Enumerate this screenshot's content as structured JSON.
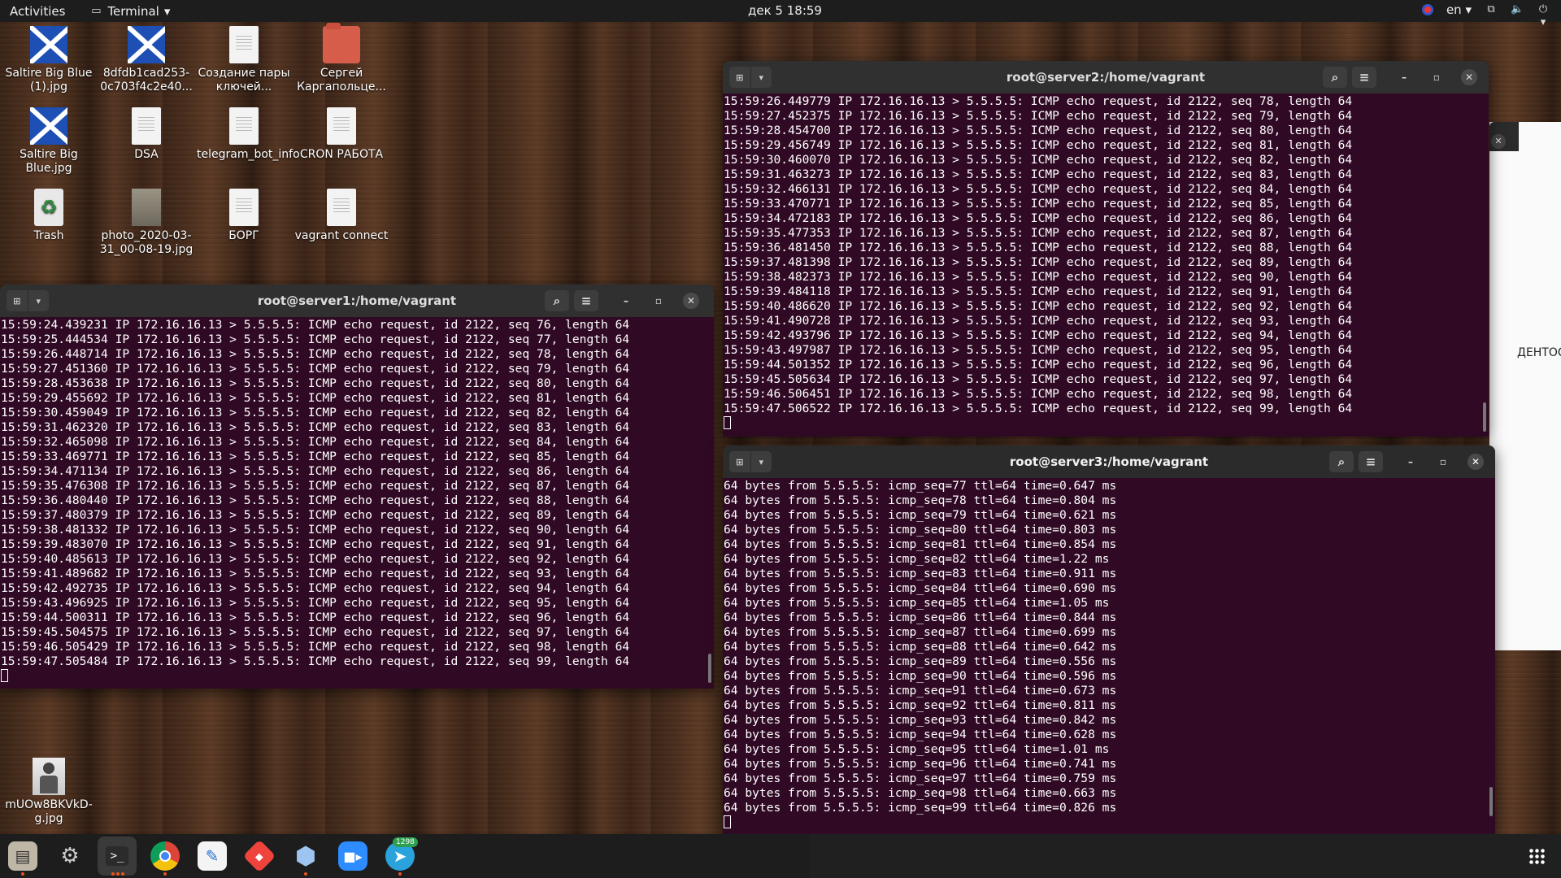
{
  "topbar": {
    "activities": "Activities",
    "app_menu": "Terminal",
    "clock": "дек 5  18:59",
    "language": "en"
  },
  "desktop_icons": [
    {
      "label": "Saltire Big Blue (1).jpg",
      "icon": "image-flag-icon"
    },
    {
      "label": "8dfdb1cad253-0c703f4c2e40...",
      "icon": "image-flag-icon"
    },
    {
      "label": "Создание пары ключей...",
      "icon": "document-icon"
    },
    {
      "label": "Сергей Каргапольце...",
      "icon": "folder-icon"
    },
    {
      "label": "Saltire Big Blue.jpg",
      "icon": "image-flag-icon"
    },
    {
      "label": "DSA",
      "icon": "document-icon"
    },
    {
      "label": "telegram_bot_info",
      "icon": "document-icon"
    },
    {
      "label": "CRON РАБОТА",
      "icon": "document-icon"
    },
    {
      "label": "Trash",
      "icon": "trash-icon"
    },
    {
      "label": "photo_2020-03-31_00-08-19.jpg",
      "icon": "image-icon"
    },
    {
      "label": "БОРГ",
      "icon": "document-icon"
    },
    {
      "label": "vagrant connect",
      "icon": "document-icon"
    },
    {
      "label": "mUOw8BKVkD-g.jpg",
      "icon": "image-person-icon"
    }
  ],
  "terminals": {
    "server1": {
      "title": "root@server1:/home/vagrant",
      "lines": [
        "15:59:24.439231 IP 172.16.16.13 > 5.5.5.5: ICMP echo request, id 2122, seq 76, length 64",
        "15:59:25.444534 IP 172.16.16.13 > 5.5.5.5: ICMP echo request, id 2122, seq 77, length 64",
        "15:59:26.448714 IP 172.16.16.13 > 5.5.5.5: ICMP echo request, id 2122, seq 78, length 64",
        "15:59:27.451360 IP 172.16.16.13 > 5.5.5.5: ICMP echo request, id 2122, seq 79, length 64",
        "15:59:28.453638 IP 172.16.16.13 > 5.5.5.5: ICMP echo request, id 2122, seq 80, length 64",
        "15:59:29.455692 IP 172.16.16.13 > 5.5.5.5: ICMP echo request, id 2122, seq 81, length 64",
        "15:59:30.459049 IP 172.16.16.13 > 5.5.5.5: ICMP echo request, id 2122, seq 82, length 64",
        "15:59:31.462320 IP 172.16.16.13 > 5.5.5.5: ICMP echo request, id 2122, seq 83, length 64",
        "15:59:32.465098 IP 172.16.16.13 > 5.5.5.5: ICMP echo request, id 2122, seq 84, length 64",
        "15:59:33.469771 IP 172.16.16.13 > 5.5.5.5: ICMP echo request, id 2122, seq 85, length 64",
        "15:59:34.471134 IP 172.16.16.13 > 5.5.5.5: ICMP echo request, id 2122, seq 86, length 64",
        "15:59:35.476308 IP 172.16.16.13 > 5.5.5.5: ICMP echo request, id 2122, seq 87, length 64",
        "15:59:36.480440 IP 172.16.16.13 > 5.5.5.5: ICMP echo request, id 2122, seq 88, length 64",
        "15:59:37.480379 IP 172.16.16.13 > 5.5.5.5: ICMP echo request, id 2122, seq 89, length 64",
        "15:59:38.481332 IP 172.16.16.13 > 5.5.5.5: ICMP echo request, id 2122, seq 90, length 64",
        "15:59:39.483070 IP 172.16.16.13 > 5.5.5.5: ICMP echo request, id 2122, seq 91, length 64",
        "15:59:40.485613 IP 172.16.16.13 > 5.5.5.5: ICMP echo request, id 2122, seq 92, length 64",
        "15:59:41.489682 IP 172.16.16.13 > 5.5.5.5: ICMP echo request, id 2122, seq 93, length 64",
        "15:59:42.492735 IP 172.16.16.13 > 5.5.5.5: ICMP echo request, id 2122, seq 94, length 64",
        "15:59:43.496925 IP 172.16.16.13 > 5.5.5.5: ICMP echo request, id 2122, seq 95, length 64",
        "15:59:44.500311 IP 172.16.16.13 > 5.5.5.5: ICMP echo request, id 2122, seq 96, length 64",
        "15:59:45.504575 IP 172.16.16.13 > 5.5.5.5: ICMP echo request, id 2122, seq 97, length 64",
        "15:59:46.505429 IP 172.16.16.13 > 5.5.5.5: ICMP echo request, id 2122, seq 98, length 64",
        "15:59:47.505484 IP 172.16.16.13 > 5.5.5.5: ICMP echo request, id 2122, seq 99, length 64"
      ]
    },
    "server2": {
      "title": "root@server2:/home/vagrant",
      "lines": [
        "15:59:26.449779 IP 172.16.16.13 > 5.5.5.5: ICMP echo request, id 2122, seq 78, length 64",
        "15:59:27.452375 IP 172.16.16.13 > 5.5.5.5: ICMP echo request, id 2122, seq 79, length 64",
        "15:59:28.454700 IP 172.16.16.13 > 5.5.5.5: ICMP echo request, id 2122, seq 80, length 64",
        "15:59:29.456749 IP 172.16.16.13 > 5.5.5.5: ICMP echo request, id 2122, seq 81, length 64",
        "15:59:30.460070 IP 172.16.16.13 > 5.5.5.5: ICMP echo request, id 2122, seq 82, length 64",
        "15:59:31.463273 IP 172.16.16.13 > 5.5.5.5: ICMP echo request, id 2122, seq 83, length 64",
        "15:59:32.466131 IP 172.16.16.13 > 5.5.5.5: ICMP echo request, id 2122, seq 84, length 64",
        "15:59:33.470771 IP 172.16.16.13 > 5.5.5.5: ICMP echo request, id 2122, seq 85, length 64",
        "15:59:34.472183 IP 172.16.16.13 > 5.5.5.5: ICMP echo request, id 2122, seq 86, length 64",
        "15:59:35.477353 IP 172.16.16.13 > 5.5.5.5: ICMP echo request, id 2122, seq 87, length 64",
        "15:59:36.481450 IP 172.16.16.13 > 5.5.5.5: ICMP echo request, id 2122, seq 88, length 64",
        "15:59:37.481398 IP 172.16.16.13 > 5.5.5.5: ICMP echo request, id 2122, seq 89, length 64",
        "15:59:38.482373 IP 172.16.16.13 > 5.5.5.5: ICMP echo request, id 2122, seq 90, length 64",
        "15:59:39.484118 IP 172.16.16.13 > 5.5.5.5: ICMP echo request, id 2122, seq 91, length 64",
        "15:59:40.486620 IP 172.16.16.13 > 5.5.5.5: ICMP echo request, id 2122, seq 92, length 64",
        "15:59:41.490728 IP 172.16.16.13 > 5.5.5.5: ICMP echo request, id 2122, seq 93, length 64",
        "15:59:42.493796 IP 172.16.16.13 > 5.5.5.5: ICMP echo request, id 2122, seq 94, length 64",
        "15:59:43.497987 IP 172.16.16.13 > 5.5.5.5: ICMP echo request, id 2122, seq 95, length 64",
        "15:59:44.501352 IP 172.16.16.13 > 5.5.5.5: ICMP echo request, id 2122, seq 96, length 64",
        "15:59:45.505634 IP 172.16.16.13 > 5.5.5.5: ICMP echo request, id 2122, seq 97, length 64",
        "15:59:46.506451 IP 172.16.16.13 > 5.5.5.5: ICMP echo request, id 2122, seq 98, length 64",
        "15:59:47.506522 IP 172.16.16.13 > 5.5.5.5: ICMP echo request, id 2122, seq 99, length 64"
      ]
    },
    "server3": {
      "title": "root@server3:/home/vagrant",
      "lines": [
        "64 bytes from 5.5.5.5: icmp_seq=77 ttl=64 time=0.647 ms",
        "64 bytes from 5.5.5.5: icmp_seq=78 ttl=64 time=0.804 ms",
        "64 bytes from 5.5.5.5: icmp_seq=79 ttl=64 time=0.621 ms",
        "64 bytes from 5.5.5.5: icmp_seq=80 ttl=64 time=0.803 ms",
        "64 bytes from 5.5.5.5: icmp_seq=81 ttl=64 time=0.854 ms",
        "64 bytes from 5.5.5.5: icmp_seq=82 ttl=64 time=1.22 ms",
        "64 bytes from 5.5.5.5: icmp_seq=83 ttl=64 time=0.911 ms",
        "64 bytes from 5.5.5.5: icmp_seq=84 ttl=64 time=0.690 ms",
        "64 bytes from 5.5.5.5: icmp_seq=85 ttl=64 time=1.05 ms",
        "64 bytes from 5.5.5.5: icmp_seq=86 ttl=64 time=0.844 ms",
        "64 bytes from 5.5.5.5: icmp_seq=87 ttl=64 time=0.699 ms",
        "64 bytes from 5.5.5.5: icmp_seq=88 ttl=64 time=0.642 ms",
        "64 bytes from 5.5.5.5: icmp_seq=89 ttl=64 time=0.556 ms",
        "64 bytes from 5.5.5.5: icmp_seq=90 ttl=64 time=0.596 ms",
        "64 bytes from 5.5.5.5: icmp_seq=91 ttl=64 time=0.673 ms",
        "64 bytes from 5.5.5.5: icmp_seq=92 ttl=64 time=0.811 ms",
        "64 bytes from 5.5.5.5: icmp_seq=93 ttl=64 time=0.842 ms",
        "64 bytes from 5.5.5.5: icmp_seq=94 ttl=64 time=0.628 ms",
        "64 bytes from 5.5.5.5: icmp_seq=95 ttl=64 time=1.01 ms",
        "64 bytes from 5.5.5.5: icmp_seq=96 ttl=64 time=0.741 ms",
        "64 bytes from 5.5.5.5: icmp_seq=97 ttl=64 time=0.759 ms",
        "64 bytes from 5.5.5.5: icmp_seq=98 ttl=64 time=0.663 ms",
        "64 bytes from 5.5.5.5: icmp_seq=99 ttl=64 time=0.826 ms"
      ]
    }
  },
  "background_window": {
    "visible_text": "ДЕНТОС"
  },
  "dock": {
    "items": [
      {
        "name": "files-icon"
      },
      {
        "name": "settings-icon"
      },
      {
        "name": "terminal-icon"
      },
      {
        "name": "chrome-icon"
      },
      {
        "name": "text-editor-icon"
      },
      {
        "name": "anydesk-icon"
      },
      {
        "name": "virtualbox-icon"
      },
      {
        "name": "zoom-icon"
      },
      {
        "name": "telegram-icon"
      }
    ],
    "telegram_badge": "1298"
  },
  "colors": {
    "terminal_bg": "#300a24",
    "accent_close": "#e95420",
    "topbar": "#1d1d1d"
  }
}
